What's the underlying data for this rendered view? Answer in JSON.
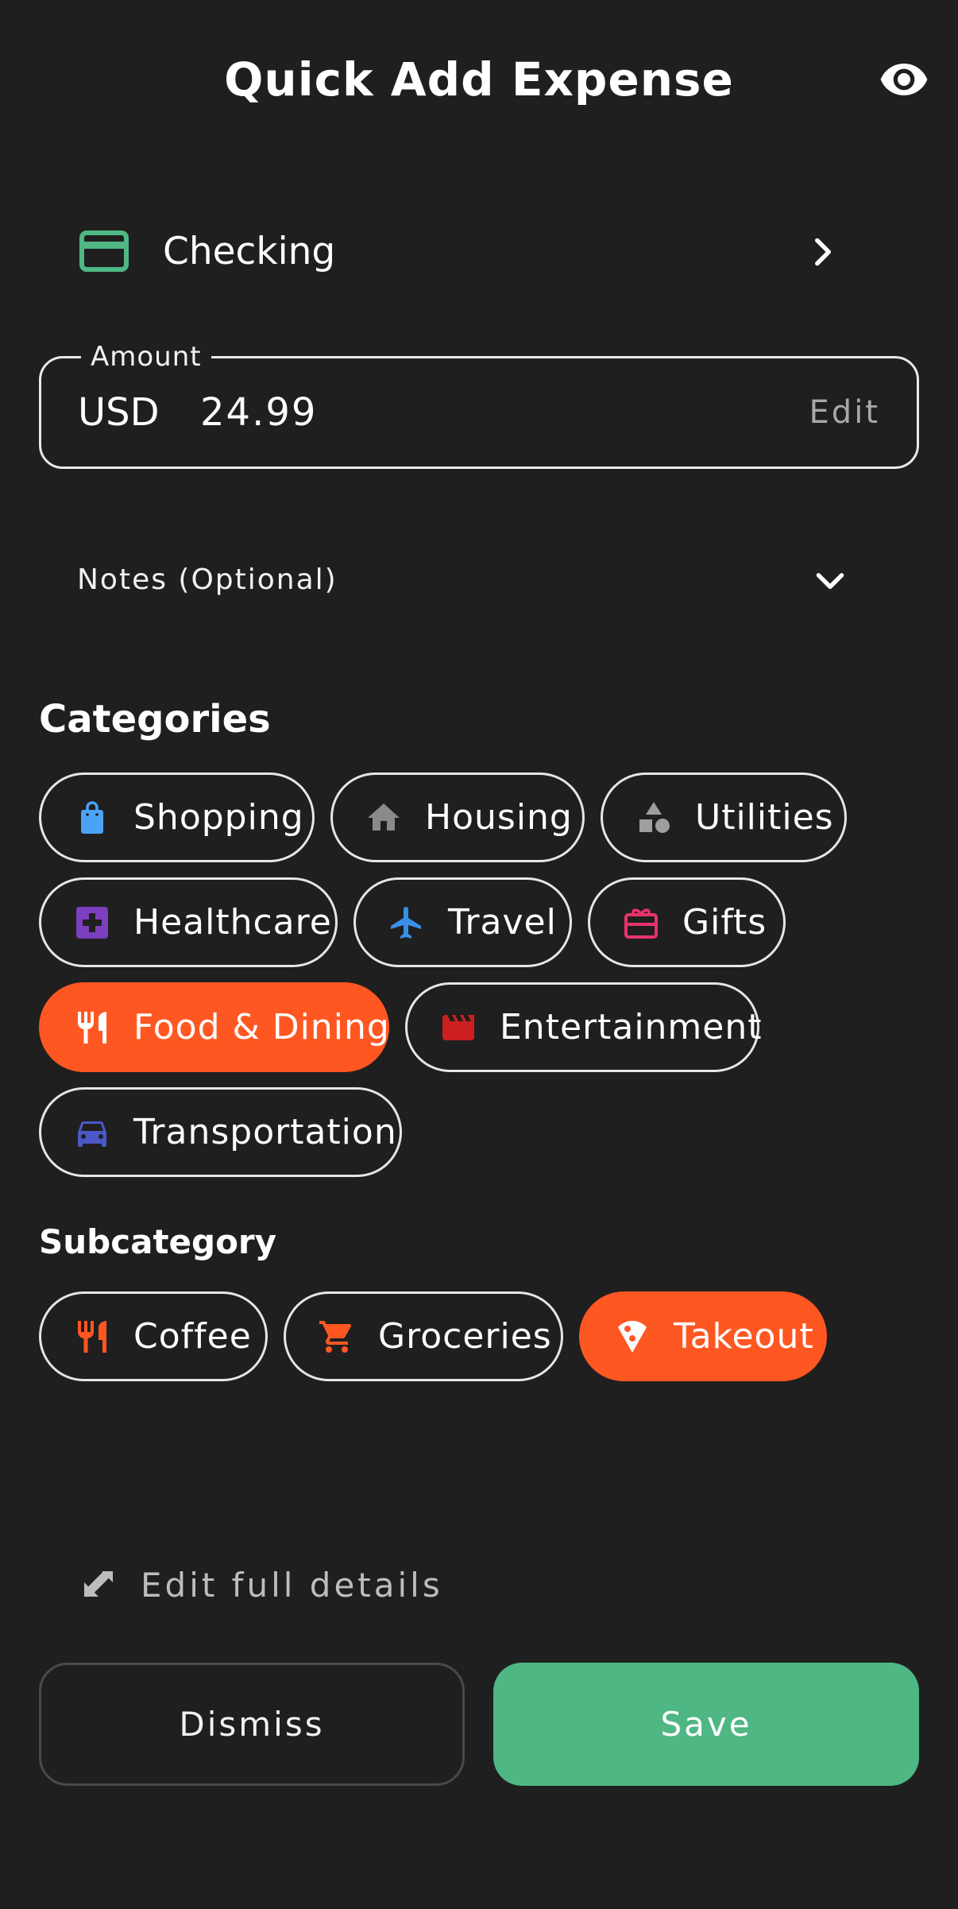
{
  "header": {
    "title": "Quick Add Expense",
    "visibility_icon": "eye-icon"
  },
  "account": {
    "label": "Checking",
    "icon": "credit-card-icon",
    "icon_color": "#4fb784"
  },
  "amount": {
    "legend": "Amount",
    "currency": "USD",
    "value": "24.99",
    "edit_label": "Edit"
  },
  "notes": {
    "label": "Notes (Optional)"
  },
  "categories": {
    "title": "Categories",
    "items": [
      {
        "label": "Shopping",
        "icon": "shopping-bag-icon",
        "color": "#4aa3f5",
        "selected": false
      },
      {
        "label": "Housing",
        "icon": "home-icon",
        "color": "#8a8a8a",
        "selected": false
      },
      {
        "label": "Utilities",
        "icon": "shapes-icon",
        "color": "#9e9e9e",
        "selected": false
      },
      {
        "label": "Healthcare",
        "icon": "medical-cross-icon",
        "color": "#7c3fbf",
        "selected": false
      },
      {
        "label": "Travel",
        "icon": "airplane-icon",
        "color": "#3a8fe8",
        "selected": false
      },
      {
        "label": "Gifts",
        "icon": "gift-card-icon",
        "color": "#e8336b",
        "selected": false
      },
      {
        "label": "Food & Dining",
        "icon": "fork-knife-icon",
        "color": "#ffffff",
        "selected": true
      },
      {
        "label": "Entertainment",
        "icon": "clapperboard-icon",
        "color": "#cc2020",
        "selected": false
      },
      {
        "label": "Transportation",
        "icon": "car-icon",
        "color": "#4b58c7",
        "selected": false
      }
    ]
  },
  "subcategory": {
    "title": "Subcategory",
    "items": [
      {
        "label": "Coffee",
        "icon": "fork-knife-icon",
        "color": "#ff5722",
        "selected": false
      },
      {
        "label": "Groceries",
        "icon": "shopping-cart-icon",
        "color": "#ff5722",
        "selected": false
      },
      {
        "label": "Takeout",
        "icon": "pizza-icon",
        "color": "#ffffff",
        "selected": true
      }
    ]
  },
  "edit_details": {
    "label": "Edit full details",
    "icon": "expand-arrows-icon"
  },
  "actions": {
    "dismiss_label": "Dismiss",
    "save_label": "Save"
  },
  "colors": {
    "background": "#1f1f1f",
    "accent": "#ff5722",
    "save": "#4fb784"
  }
}
